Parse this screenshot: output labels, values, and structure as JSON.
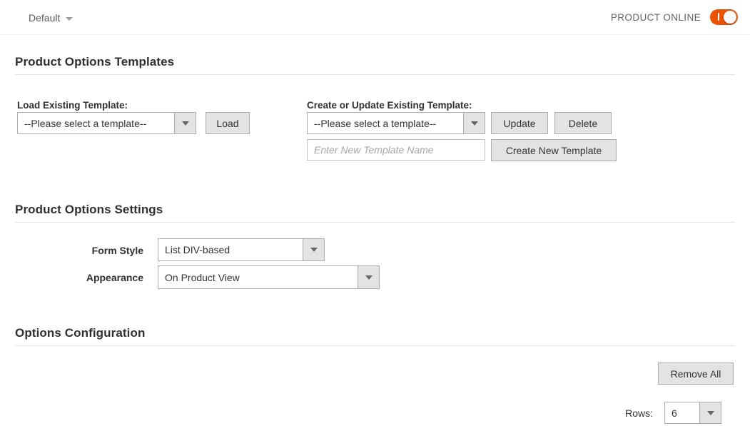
{
  "topbar": {
    "store_switcher_label": "Default",
    "product_online_label": "PRODUCT ONLINE",
    "toggle_state": "on",
    "accent_color": "#eb5202"
  },
  "templates_section": {
    "title": "Product Options Templates",
    "load_existing": {
      "label": "Load Existing Template:",
      "select_value": "--Please select a template--",
      "load_button": "Load"
    },
    "create_update": {
      "label": "Create or Update Existing Template:",
      "select_value": "--Please select a template--",
      "update_button": "Update",
      "delete_button": "Delete",
      "new_name_value": "",
      "new_name_placeholder": "Enter New Template Name",
      "create_button": "Create New Template"
    }
  },
  "settings_section": {
    "title": "Product Options Settings",
    "form_style": {
      "label": "Form Style",
      "value": "List DIV-based"
    },
    "appearance": {
      "label": "Appearance",
      "value": "On Product View"
    }
  },
  "options_configuration": {
    "title": "Options Configuration",
    "remove_all_button": "Remove All",
    "rows_label": "Rows:",
    "rows_value": "6"
  }
}
